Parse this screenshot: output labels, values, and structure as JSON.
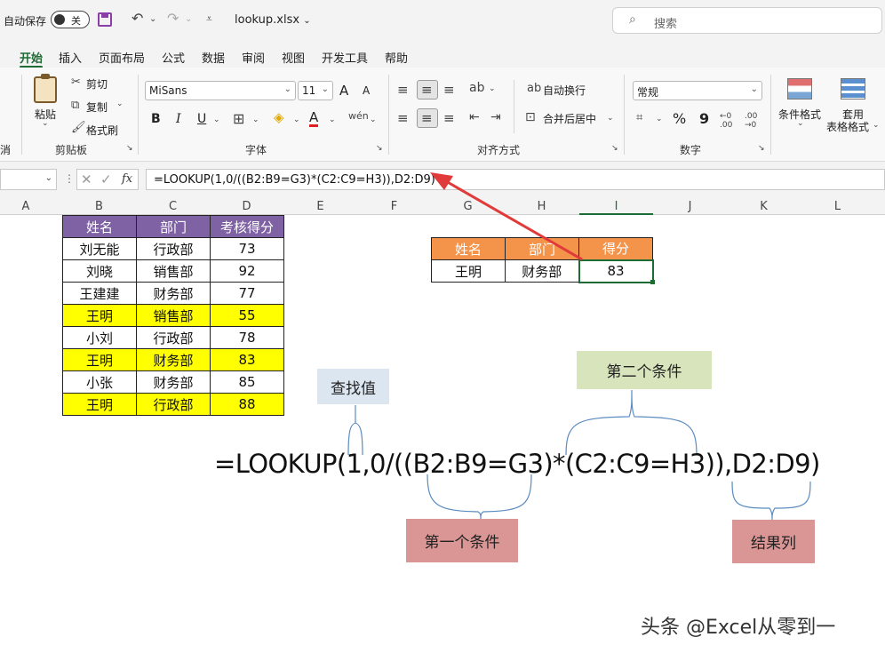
{
  "titlebar": {
    "autosave_label": "自动保存",
    "autosave_state": "关",
    "file_name": "lookup.xlsx",
    "search_placeholder": "搜索"
  },
  "tabs": [
    "开始",
    "插入",
    "页面布局",
    "公式",
    "数据",
    "审阅",
    "视图",
    "开发工具",
    "帮助"
  ],
  "ribbon": {
    "clipboard": {
      "paste": "粘贴",
      "cut": "剪切",
      "copy": "复制",
      "format_painter": "格式刷",
      "label": "剪贴板"
    },
    "font": {
      "font_name": "MiSans",
      "font_size": "11",
      "grow": "A",
      "shrink": "A",
      "bold": "B",
      "italic": "I",
      "underline": "U",
      "label": "字体"
    },
    "alignment": {
      "wrap": "自动换行",
      "merge": "合并后居中",
      "label": "对齐方式"
    },
    "number": {
      "format": "常规",
      "percent": "%",
      "comma": "9",
      "label": "数字"
    },
    "styles": {
      "conditional": "条件格式",
      "table_format_1": "套用",
      "table_format_2": "表格格式"
    },
    "cut_off_left": "消"
  },
  "formula_bar": {
    "fx": "fx",
    "formula": "=LOOKUP(1,0/((B2:B9=G3)*(C2:C9=H3)),D2:D9)"
  },
  "columns": [
    "A",
    "B",
    "C",
    "D",
    "E",
    "F",
    "G",
    "H",
    "I",
    "J",
    "K",
    "L"
  ],
  "data_table": {
    "headers": [
      "姓名",
      "部门",
      "考核得分"
    ],
    "rows": [
      {
        "name": "刘无能",
        "dept": "行政部",
        "score": "73",
        "highlight": false
      },
      {
        "name": "刘晓",
        "dept": "销售部",
        "score": "92",
        "highlight": false
      },
      {
        "name": "王建建",
        "dept": "财务部",
        "score": "77",
        "highlight": false
      },
      {
        "name": "王明",
        "dept": "销售部",
        "score": "55",
        "highlight": true
      },
      {
        "name": "小刘",
        "dept": "行政部",
        "score": "78",
        "highlight": false
      },
      {
        "name": "王明",
        "dept": "财务部",
        "score": "83",
        "highlight": true
      },
      {
        "name": "小张",
        "dept": "财务部",
        "score": "85",
        "highlight": false
      },
      {
        "name": "王明",
        "dept": "行政部",
        "score": "88",
        "highlight": true
      }
    ]
  },
  "lookup_table": {
    "headers": [
      "姓名",
      "部门",
      "得分"
    ],
    "values": [
      "王明",
      "财务部",
      "83"
    ]
  },
  "annotations": {
    "lookup_value": "查找值",
    "condition_2": "第二个条件",
    "condition_1": "第一个条件",
    "result_column": "结果列",
    "formula": "=LOOKUP(1,0/((B2:B9=G3)*(C2:C9=H3)),D2:D9)"
  },
  "watermark": "头条 @Excel从零到一",
  "colors": {
    "accent": "#1e6b33",
    "data_header": "#7f62a4",
    "highlight": "#ffff00",
    "lookup_header": "#f4934a",
    "note_blue": "#dce6f1",
    "note_green": "#d8e4bc",
    "note_red": "#da9694",
    "arrow": "#e03a3a"
  }
}
